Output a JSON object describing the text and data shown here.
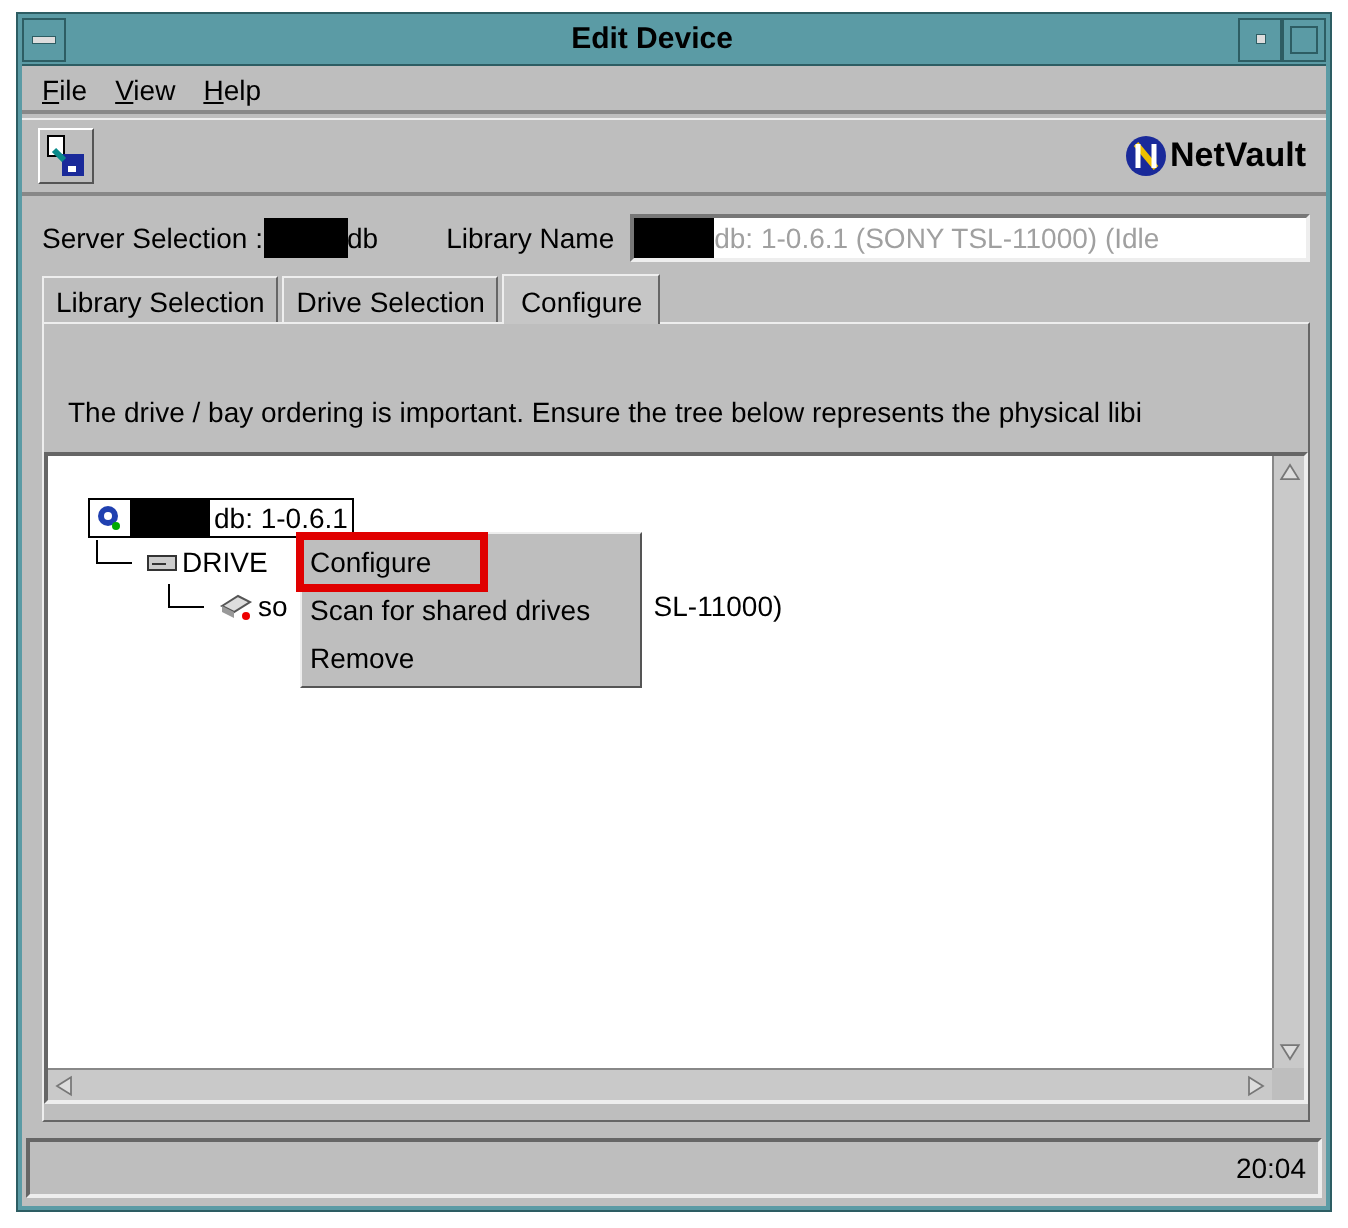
{
  "window": {
    "title": "Edit Device"
  },
  "menu_bar": [
    {
      "label": "File"
    },
    {
      "label": "View"
    },
    {
      "label": "Help"
    }
  ],
  "brand": {
    "name": "NetVault"
  },
  "server_selection": {
    "label": "Server Selection :",
    "value_suffix": "db"
  },
  "library_name": {
    "label": "Library Name",
    "value": "db: 1-0.6.1 (SONY TSL-11000) (Idle",
    "disabled": true
  },
  "tabs": [
    {
      "label": "Library Selection",
      "selected": false
    },
    {
      "label": "Drive Selection",
      "selected": false
    },
    {
      "label": "Configure",
      "selected": true
    }
  ],
  "message": "The drive / bay ordering is important. Ensure the tree below represents the physical libi",
  "tree": [
    {
      "label": "db: 1-0.6.1",
      "selected": true,
      "children": [
        {
          "label": "DRIVE",
          "selected": false,
          "children": [
            {
              "label": "so",
              "label_tail": "SL-11000)",
              "selected": false
            }
          ]
        }
      ]
    }
  ],
  "context_menu": [
    {
      "label": "Configure",
      "highlighted": true
    },
    {
      "label": "Scan for shared drives",
      "highlighted": false
    },
    {
      "label": "Remove",
      "highlighted": false
    }
  ],
  "status_bar": {
    "time": "20:04"
  }
}
